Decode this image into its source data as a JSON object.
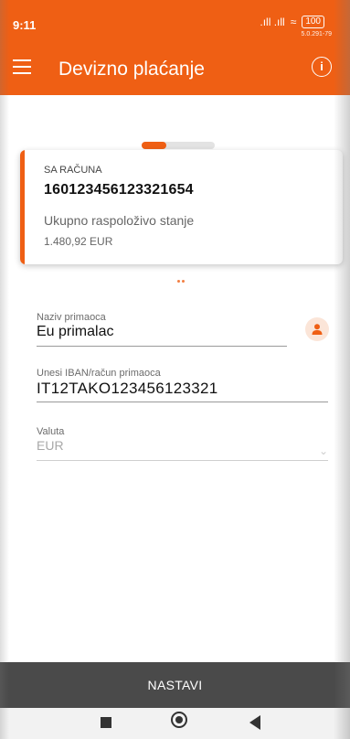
{
  "status_bar": {
    "time": "9:11",
    "signal": ".ıll .ıll",
    "wifi": "≈",
    "battery": "100",
    "version": "5.0.291-79"
  },
  "appbar": {
    "title": "Devizno plaćanje",
    "info": "i"
  },
  "pager": {
    "current_step": 1,
    "total_steps": 2
  },
  "account_card": {
    "label": "SA RAČUNA",
    "account_number": "160123456123321654",
    "available_label": "Ukupno raspoloživo stanje",
    "available_value": "1.480,92 EUR"
  },
  "form": {
    "recipient": {
      "label": "Naziv primaoca",
      "value": "Eu primalac"
    },
    "iban": {
      "label": "Unesi IBAN/račun primaoca",
      "value": "IT12TAKO123456123321"
    },
    "currency": {
      "label": "Valuta",
      "value": "EUR"
    }
  },
  "continue_button": {
    "label": "NASTAVI"
  },
  "colors": {
    "accent": "#ef5f14",
    "button_bg": "#4a4a4a"
  },
  "icons": {
    "menu": "hamburger-icon",
    "info": "info-icon",
    "contact": "person-icon",
    "dropdown": "chevron-down-icon"
  }
}
